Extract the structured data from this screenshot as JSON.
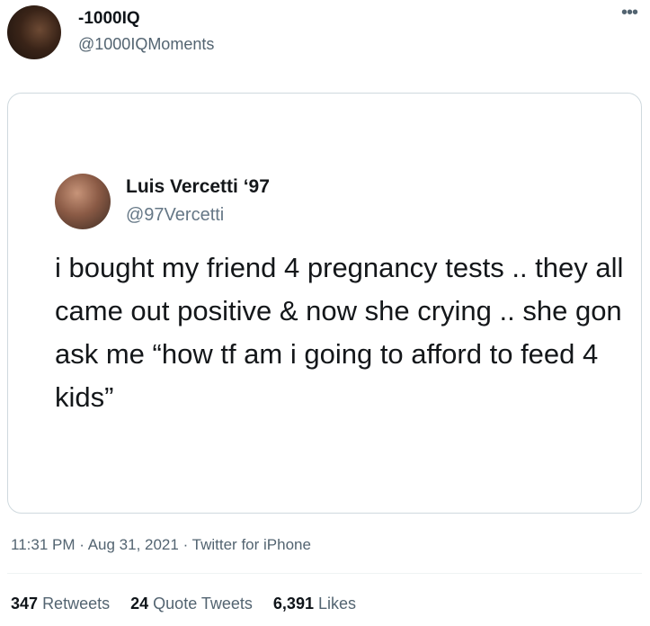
{
  "tweet": {
    "author_name": "-1000IQ",
    "author_handle": "@1000IQMoments",
    "more_glyph": "•••"
  },
  "embedded": {
    "author_name": "Luis Vercetti ‘97",
    "author_handle": "@97Vercetti",
    "text": "i bought my friend 4 pregnancy tests .. they all came out positive & now she crying .. she gon ask me “how tf am i going to afford to feed 4 kids”"
  },
  "meta": {
    "time": "11:31 PM",
    "separator": " · ",
    "date": "Aug 31, 2021",
    "source": "Twitter for iPhone"
  },
  "stats": {
    "retweets_count": "347",
    "retweets_label": "Retweets",
    "quotes_count": "24",
    "quotes_label": "Quote Tweets",
    "likes_count": "6,391",
    "likes_label": "Likes"
  },
  "colors": {
    "primary_text": "#0f1419",
    "secondary_text": "#536471",
    "border": "#cfd9de"
  }
}
